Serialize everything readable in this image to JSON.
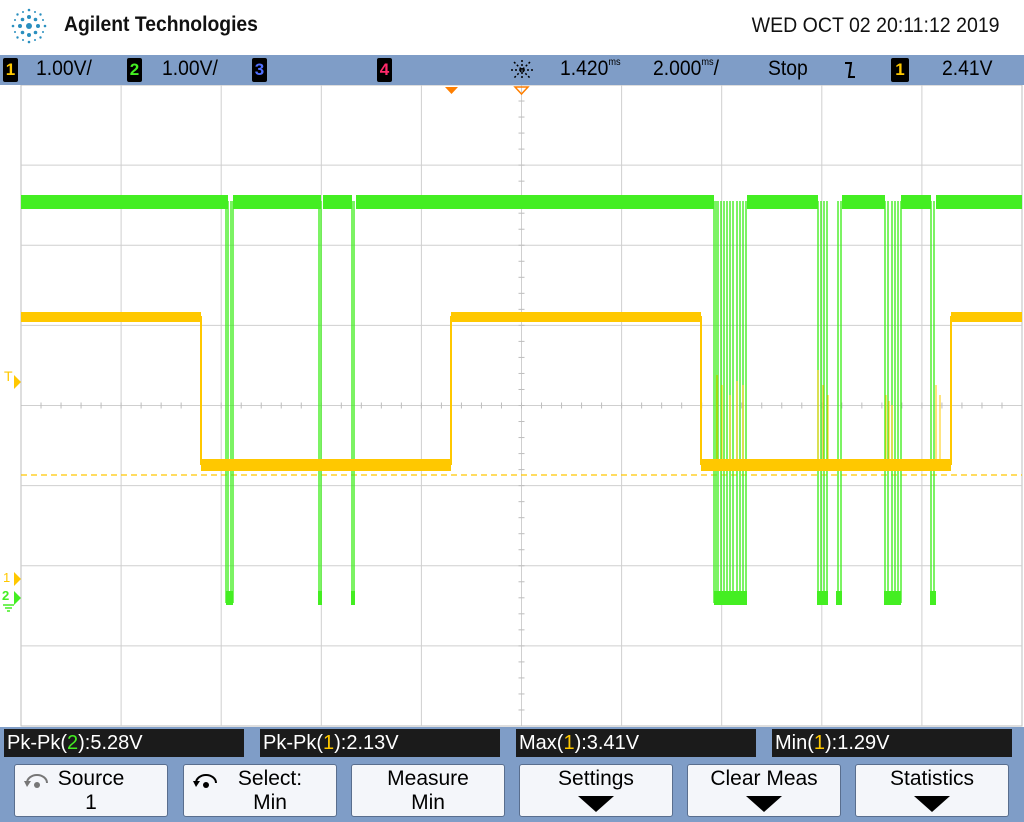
{
  "header": {
    "brand": "Agilent Technologies",
    "datetime": "WED OCT 02 20:11:12 2019",
    "logo_icon": "agilent-spark-logo-icon"
  },
  "status": {
    "ch1_num": "1",
    "ch1_scale": "1.00V/",
    "ch2_num": "2",
    "ch2_scale": "1.00V/",
    "ch3_num": "3",
    "ch4_num": "4",
    "delay_icon": "timebase-delay-icon",
    "delay": "1.420",
    "delay_unit": "ms",
    "timebase": "2.000",
    "timebase_unit": "ms",
    "timebase_suffix": "/",
    "run_state": "Stop",
    "trigger_slope_icon": "falling-edge-icon",
    "trig_src": "1",
    "trig_level": "2.41V",
    "colors": {
      "ch1": "#ffc800",
      "ch2": "#44ee22",
      "ch3": "#5070ff",
      "ch4": "#ff2a6a"
    }
  },
  "markers": {
    "trigger_level": "T",
    "ch1_ground": "1",
    "ch2_ground": "2"
  },
  "measurements": [
    {
      "label": "Pk-Pk(",
      "ch": "2",
      "close": "): ",
      "value": "5.28V"
    },
    {
      "label": "Pk-Pk(",
      "ch": "1",
      "close": "): ",
      "value": "2.13V"
    },
    {
      "label": "Max(",
      "ch": "1",
      "close": "): ",
      "value": "3.41V"
    },
    {
      "label": "Min(",
      "ch": "1",
      "close": "): ",
      "value": "1.29V"
    }
  ],
  "softkeys": [
    {
      "line1": "Source",
      "line2": "1"
    },
    {
      "line1": "Select:",
      "line2": "Min"
    },
    {
      "line1": "Measure",
      "line2": "Min"
    },
    {
      "line1": "Settings"
    },
    {
      "line1": "Clear Meas"
    },
    {
      "line1": "Statistics"
    }
  ]
}
